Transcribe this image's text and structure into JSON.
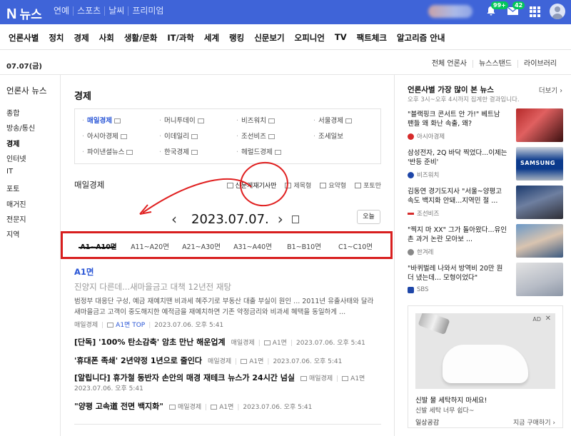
{
  "topbar": {
    "logo_n": "N",
    "logo_text": "뉴스",
    "nav": [
      "연예",
      "스포츠",
      "날씨",
      "프리미엄"
    ],
    "notif_badge": "99+",
    "mail_badge": "42",
    "accent": "#3f64d8",
    "badge_color": "#03c75a"
  },
  "catnav": [
    "언론사별",
    "정치",
    "경제",
    "사회",
    "생활/문화",
    "IT/과학",
    "세계",
    "랭킹",
    "신문보기",
    "오피니언",
    "TV",
    "팩트체크",
    "알고리즘 안내"
  ],
  "date": "07.07(금)",
  "toplinks": [
    "전체 언론사",
    "뉴스스탠드",
    "라이브러리"
  ],
  "sidebar": {
    "title": "언론사 뉴스",
    "items": [
      "종합",
      "방송/통신",
      "경제",
      "인터넷",
      "IT",
      "포토",
      "매거진",
      "전문지",
      "지역"
    ],
    "active": "경제"
  },
  "section_title": "경제",
  "presses": [
    "매일경제",
    "머니투데이",
    "비즈워치",
    "서울경제",
    "아시아경제",
    "이데일리",
    "조선비즈",
    "조세일보",
    "파이낸셜뉴스",
    "한국경제",
    "헤럴드경제"
  ],
  "paper": {
    "name": "매일경제",
    "view_options": [
      "신문게재기사만",
      "제목형",
      "요약형",
      "포토만"
    ],
    "date_display": "2023.07.07.",
    "today_label": "오늘",
    "pages": [
      "A1~A10면",
      "A11~A20면",
      "A21~A30면",
      "A31~A40면",
      "B1~B10면",
      "C1~C10면"
    ],
    "section_label": "A1면",
    "lead": {
      "title": "진양지 다른데...새마을금고 대책 12년전 재탕",
      "body": "범정부 대응단 구성, 예금 재예치땐 비과세 혜주기로 부동산 대출 부실이 원인 ... 2011년 유출사태와 달라 새마을금고 고객이 중도해지한 예적금을 재예치하면 기존 약정금리와 비과세 혜택을 동일하게 ...",
      "press": "매일경제",
      "page": "A1면 TOP",
      "time": "2023.07.06. 오후 5:41"
    },
    "articles": [
      {
        "title": "[단독] '100% 탄소감축' 암초 만난 해운업계",
        "press": "매일경제",
        "page": "A1면",
        "time": "2023.07.06. 오후 5:41"
      },
      {
        "title": "'휴대폰 족쇄' 2년약정 1년으로 줄인다",
        "press": "매일경제",
        "page": "A1면",
        "time": "2023.07.06. 오후 5:41"
      },
      {
        "title": "[알립니다] 휴가철 동반자 손안의 매경 재테크 뉴스가 24시간 넘실",
        "press": "매일경제",
        "page": "A1면",
        "time": "2023.07.06. 오후 5:41"
      },
      {
        "title": "\"양평 고속道 전면 백지화\"",
        "press": "매일경제",
        "page": "A1면",
        "time": "2023.07.06. 오후 5:41"
      }
    ]
  },
  "right": {
    "title": "언론사별 가장 많이 본 뉴스",
    "more": "더보기",
    "subtitle": "오후 3시~오후 4시까지 집계한 결과입니다.",
    "ranking": [
      {
        "text": "\"블랙핑크 콘서트 안 가!\" 베트남 팬들 왜 화난 속출, 왜?",
        "source": "아시아경제",
        "color": "#d62b2b"
      },
      {
        "text": "삼성전자, 2Q 바닥 찍었다...이제는 '반등 준비'",
        "source": "비즈워치",
        "color": "#1e46a8",
        "thumb_text": "SAMSUNG"
      },
      {
        "text": "김동연 경기도지사 \"서울~양평고속도 백지화 안돼...지역민 절 ...",
        "source": "조선비즈",
        "color": "#d62b2b"
      },
      {
        "text": "\"찍지 마 XX\" 그가 돌아왔다...유인촌 과거 논란 모아보 ...",
        "source": "한겨레",
        "color": "#888888"
      },
      {
        "text": "\"바퀴벌레 나와서 방역비 20만 원 더 냈는데... 모형이었다\"",
        "source": "SBS",
        "color": "#1e46a8"
      }
    ],
    "ad": {
      "label": "AD",
      "close": "✕",
      "headline": "신발 물 세탁하지 마세요!",
      "sub": "신발 세탁 너무 쉽다~",
      "brand": "일상공감",
      "cta": "지금 구매하기 ›"
    }
  }
}
